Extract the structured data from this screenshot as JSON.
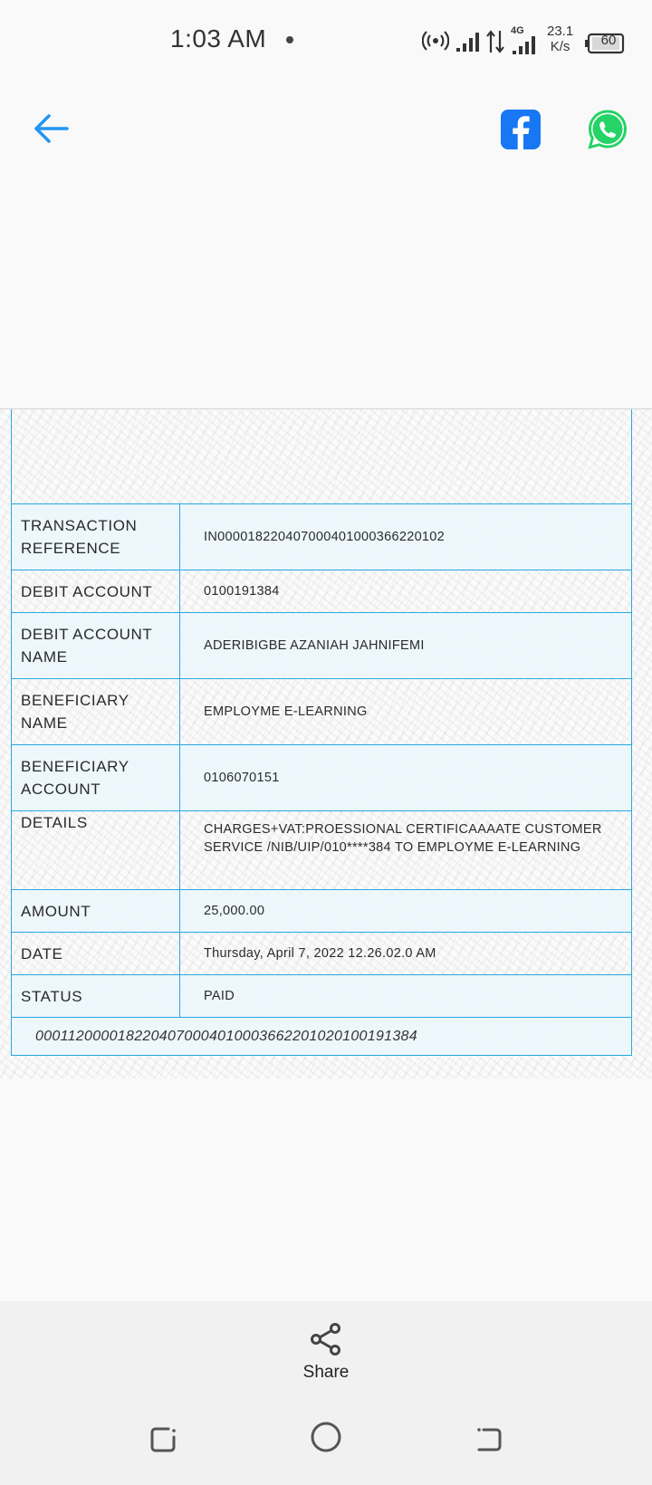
{
  "status_bar": {
    "time": "1:03 AM",
    "network": "4G",
    "speed_value": "23.1",
    "speed_unit": "K/s",
    "battery": "60"
  },
  "toolbar": {
    "back_icon": "arrow-left",
    "share_icons": [
      "facebook",
      "whatsapp"
    ]
  },
  "receipt": {
    "rows": [
      {
        "label": "TRANSACTION REFERENCE",
        "value": "IN00001822040700040100036622​0102"
      },
      {
        "label": "DEBIT ACCOUNT",
        "value": "0100191384"
      },
      {
        "label": "DEBIT ACCOUNT NAME",
        "value": "ADERIBIGBE AZANIAH JAHNIFEMI"
      },
      {
        "label": "BENEFICIARY NAME",
        "value": "EMPLOYME E-LEARNING"
      },
      {
        "label": "BENEFICIARY ACCOUNT",
        "value": "0106070151"
      },
      {
        "label": "DETAILS",
        "value": "CHARGES+VAT:PROESSIONAL CERTIFICAAAATE CUSTOMER SERVICE /NIB/UIP/010****384 TO EMPLOYME E-LEARNING"
      },
      {
        "label": "AMOUNT",
        "value": "25,000.00"
      },
      {
        "label": "DATE",
        "value": "Thursday, April 7, 2022 12.26.02.0 AM"
      },
      {
        "label": "STATUS",
        "value": "PAID"
      }
    ],
    "footer_reference": "000112000018220407000401000366220102010019​1384"
  },
  "share": {
    "label": "Share"
  },
  "colors": {
    "accent": "#2196f3",
    "table_border": "#29a8e0",
    "facebook": "#1877f2",
    "whatsapp": "#25d366"
  }
}
